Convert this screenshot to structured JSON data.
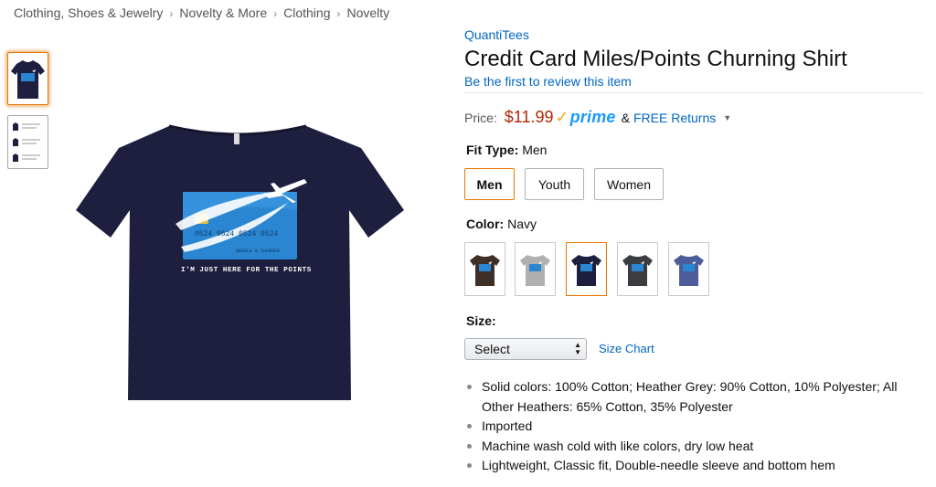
{
  "breadcrumb": [
    "Clothing, Shoes & Jewelry",
    "Novelty & More",
    "Clothing",
    "Novelty"
  ],
  "breadcrumb_separator": "›",
  "product": {
    "brand": "QuantiTees",
    "title": "Credit Card Miles/Points Churning Shirt",
    "review_link": "Be the first to review this item",
    "shirt_print_text": "I'M JUST HERE FOR THE POINTS",
    "card_number_text": "0524 0524 0524 0524",
    "card_holder_text": "BEEBLE B CHURNER"
  },
  "price": {
    "label": "Price:",
    "value": "$11.99",
    "prime_check": "✓",
    "prime_word": "prime",
    "amp": "&",
    "free_returns": "FREE Returns",
    "caret": "▼"
  },
  "fit": {
    "label": "Fit Type:",
    "selected": "Men",
    "options": [
      "Men",
      "Youth",
      "Women"
    ]
  },
  "color": {
    "label": "Color:",
    "selected": "Navy",
    "swatches": [
      {
        "name": "Brown",
        "hex": "#3f2f26"
      },
      {
        "name": "Heather Grey",
        "hex": "#b0b0b0"
      },
      {
        "name": "Navy",
        "hex": "#1e1f3f"
      },
      {
        "name": "Dark Heather",
        "hex": "#3b3d40"
      },
      {
        "name": "Heather Blue",
        "hex": "#4d5d9a"
      }
    ]
  },
  "size": {
    "label": "Size:",
    "select_value": "Select",
    "size_chart": "Size Chart"
  },
  "features": [
    "Solid colors: 100% Cotton; Heather Grey: 90% Cotton, 10% Polyester; All Other Heathers: 65% Cotton, 35% Polyester",
    "Imported",
    "Machine wash cold with like colors, dry low heat",
    "Lightweight, Classic fit, Double-needle sleeve and bottom hem"
  ],
  "colors": {
    "link": "#0066c0",
    "price": "#b12704",
    "prime_blue": "#1a98ff",
    "prime_check": "#f7a61c",
    "selected_border": "#e77600",
    "navy_shirt": "#1e1f3f",
    "card_blue": "#2a86d1"
  }
}
